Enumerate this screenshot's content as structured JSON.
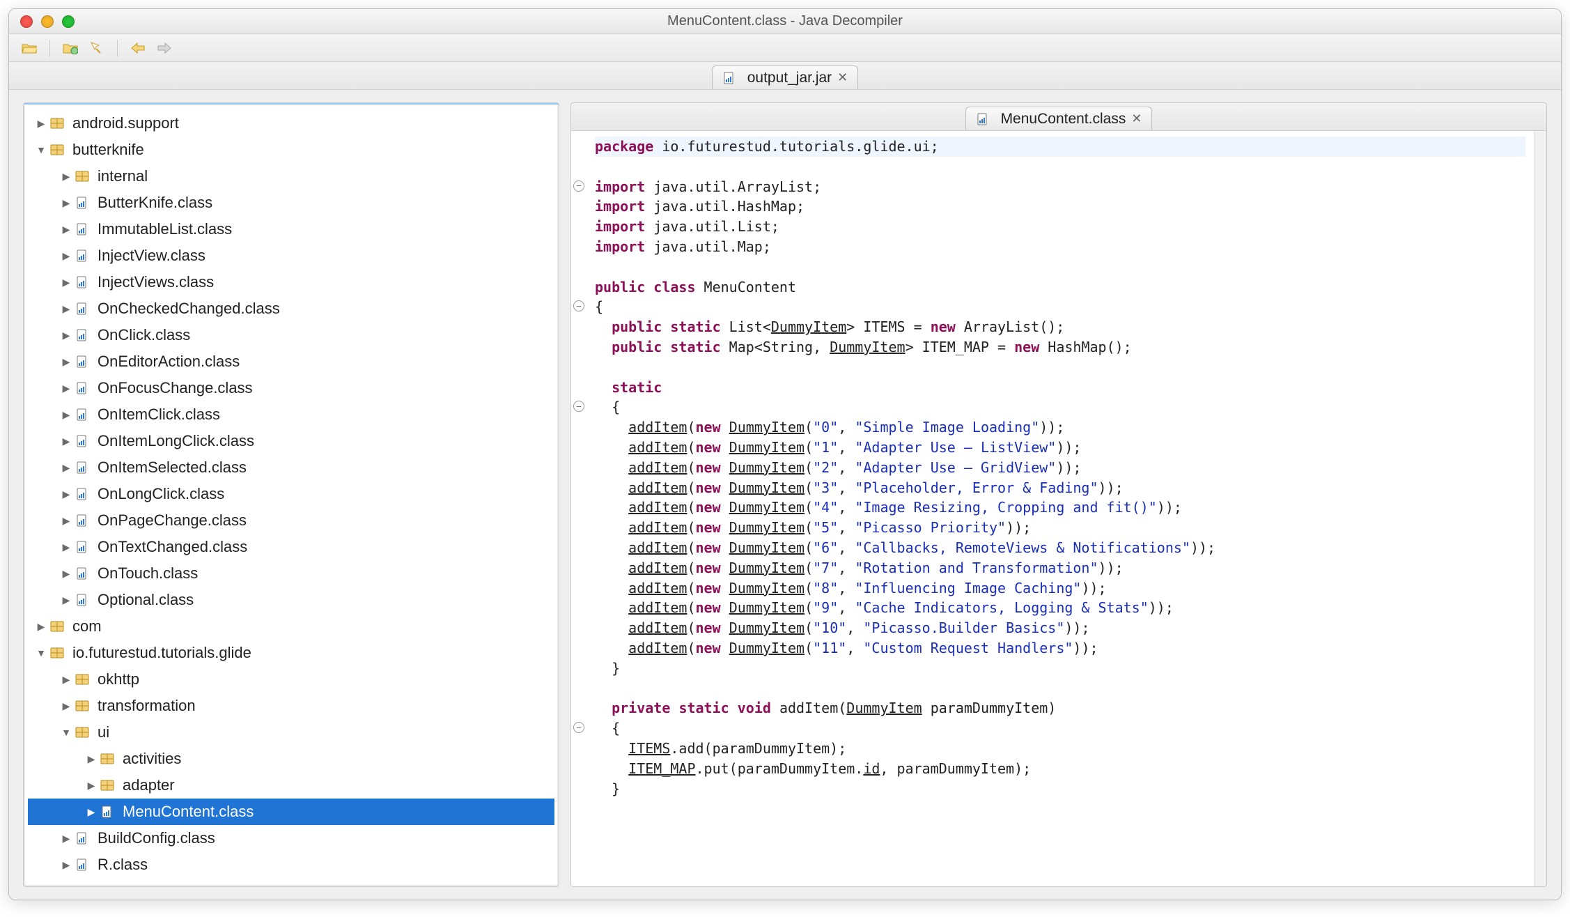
{
  "window": {
    "title": "MenuContent.class - Java Decompiler"
  },
  "topTab": {
    "label": "output_jar.jar"
  },
  "editorTab": {
    "label": "MenuContent.class"
  },
  "tree": [
    {
      "depth": 0,
      "exp": "▶",
      "icon": "pkg",
      "label": "android.support",
      "selected": false
    },
    {
      "depth": 0,
      "exp": "▼",
      "icon": "pkg",
      "label": "butterknife",
      "selected": false
    },
    {
      "depth": 1,
      "exp": "▶",
      "icon": "pkg",
      "label": "internal",
      "selected": false
    },
    {
      "depth": 1,
      "exp": "▶",
      "icon": "cls",
      "label": "ButterKnife.class",
      "selected": false
    },
    {
      "depth": 1,
      "exp": "▶",
      "icon": "cls",
      "label": "ImmutableList.class",
      "selected": false
    },
    {
      "depth": 1,
      "exp": "▶",
      "icon": "cls",
      "label": "InjectView.class",
      "selected": false
    },
    {
      "depth": 1,
      "exp": "▶",
      "icon": "cls",
      "label": "InjectViews.class",
      "selected": false
    },
    {
      "depth": 1,
      "exp": "▶",
      "icon": "cls",
      "label": "OnCheckedChanged.class",
      "selected": false
    },
    {
      "depth": 1,
      "exp": "▶",
      "icon": "cls",
      "label": "OnClick.class",
      "selected": false
    },
    {
      "depth": 1,
      "exp": "▶",
      "icon": "cls",
      "label": "OnEditorAction.class",
      "selected": false
    },
    {
      "depth": 1,
      "exp": "▶",
      "icon": "cls",
      "label": "OnFocusChange.class",
      "selected": false
    },
    {
      "depth": 1,
      "exp": "▶",
      "icon": "cls",
      "label": "OnItemClick.class",
      "selected": false
    },
    {
      "depth": 1,
      "exp": "▶",
      "icon": "cls",
      "label": "OnItemLongClick.class",
      "selected": false
    },
    {
      "depth": 1,
      "exp": "▶",
      "icon": "cls",
      "label": "OnItemSelected.class",
      "selected": false
    },
    {
      "depth": 1,
      "exp": "▶",
      "icon": "cls",
      "label": "OnLongClick.class",
      "selected": false
    },
    {
      "depth": 1,
      "exp": "▶",
      "icon": "cls",
      "label": "OnPageChange.class",
      "selected": false
    },
    {
      "depth": 1,
      "exp": "▶",
      "icon": "cls",
      "label": "OnTextChanged.class",
      "selected": false
    },
    {
      "depth": 1,
      "exp": "▶",
      "icon": "cls",
      "label": "OnTouch.class",
      "selected": false
    },
    {
      "depth": 1,
      "exp": "▶",
      "icon": "cls",
      "label": "Optional.class",
      "selected": false
    },
    {
      "depth": 0,
      "exp": "▶",
      "icon": "pkg",
      "label": "com",
      "selected": false
    },
    {
      "depth": 0,
      "exp": "▼",
      "icon": "pkg",
      "label": "io.futurestud.tutorials.glide",
      "selected": false
    },
    {
      "depth": 1,
      "exp": "▶",
      "icon": "pkg",
      "label": "okhttp",
      "selected": false
    },
    {
      "depth": 1,
      "exp": "▶",
      "icon": "pkg",
      "label": "transformation",
      "selected": false
    },
    {
      "depth": 1,
      "exp": "▼",
      "icon": "pkg",
      "label": "ui",
      "selected": false
    },
    {
      "depth": 2,
      "exp": "▶",
      "icon": "pkg",
      "label": "activities",
      "selected": false
    },
    {
      "depth": 2,
      "exp": "▶",
      "icon": "pkg",
      "label": "adapter",
      "selected": false
    },
    {
      "depth": 2,
      "exp": "▶",
      "icon": "cls",
      "label": "MenuContent.class",
      "selected": true
    },
    {
      "depth": 1,
      "exp": "▶",
      "icon": "cls",
      "label": "BuildConfig.class",
      "selected": false
    },
    {
      "depth": 1,
      "exp": "▶",
      "icon": "cls",
      "label": "R.class",
      "selected": false
    }
  ],
  "code": {
    "package": "io.futurestud.tutorials.glide.ui",
    "imports": [
      "java.util.ArrayList",
      "java.util.HashMap",
      "java.util.List",
      "java.util.Map"
    ],
    "className": "MenuContent",
    "fields": [
      {
        "type": "List",
        "generic": "DummyItem",
        "name": "ITEMS",
        "init": "ArrayList"
      },
      {
        "type": "Map",
        "generic": "String, DummyItem",
        "name": "ITEM_MAP",
        "init": "HashMap"
      }
    ],
    "items": [
      {
        "id": "0",
        "title": "Simple Image Loading"
      },
      {
        "id": "1",
        "title": "Adapter Use — ListView"
      },
      {
        "id": "2",
        "title": "Adapter Use — GridView"
      },
      {
        "id": "3",
        "title": "Placeholder, Error & Fading"
      },
      {
        "id": "4",
        "title": "Image Resizing, Cropping and fit()"
      },
      {
        "id": "5",
        "title": "Picasso Priority"
      },
      {
        "id": "6",
        "title": "Callbacks, RemoteViews & Notifications"
      },
      {
        "id": "7",
        "title": "Rotation and Transformation"
      },
      {
        "id": "8",
        "title": "Influencing Image Caching"
      },
      {
        "id": "9",
        "title": "Cache Indicators, Logging & Stats"
      },
      {
        "id": "10",
        "title": "Picasso.Builder Basics"
      },
      {
        "id": "11",
        "title": "Custom Request Handlers"
      }
    ],
    "method": {
      "signature": "private static void addItem(DummyItem paramDummyItem)",
      "body": [
        "ITEMS.add(paramDummyItem);",
        "ITEM_MAP.put(paramDummyItem.id, paramDummyItem);"
      ]
    }
  }
}
